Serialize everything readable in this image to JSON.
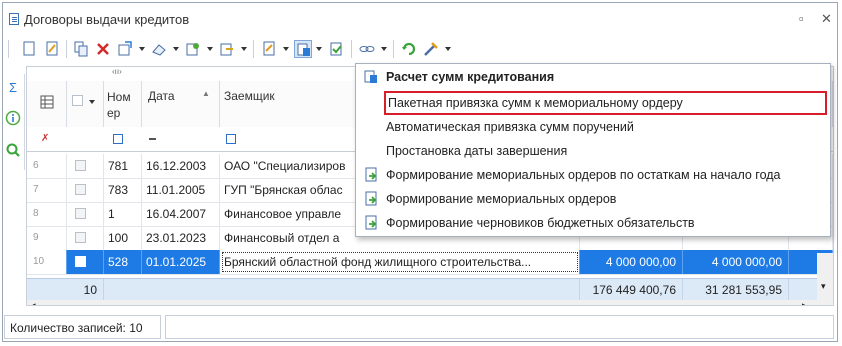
{
  "window": {
    "title": "Договоры выдачи кредитов",
    "restore_glyph": "▫",
    "close_glyph": "✕"
  },
  "grid": {
    "columns": {
      "number": "Ном ер",
      "date": "Дата",
      "borrower": "Заемщик"
    },
    "rows": [
      {
        "rownum": "6",
        "number": "781",
        "date": "16.12.2003",
        "borrower": "ОАО \"Специализиров",
        "sum1": "",
        "sum2": "",
        "selected": false
      },
      {
        "rownum": "7",
        "number": "783",
        "date": "11.01.2005",
        "borrower": "ГУП \"Брянская облас",
        "sum1": "",
        "sum2": "",
        "selected": false
      },
      {
        "rownum": "8",
        "number": "1",
        "date": "16.04.2007",
        "borrower": "Финансовое управле",
        "sum1": "",
        "sum2": "",
        "selected": false
      },
      {
        "rownum": "9",
        "number": "100",
        "date": "23.01.2023",
        "borrower": "Финансовый отдел а",
        "sum1": "",
        "sum2": "",
        "selected": false
      },
      {
        "rownum": "10",
        "number": "528",
        "date": "01.01.2025",
        "borrower": "Брянский областной фонд жилищного строительства...",
        "sum1": "4 000 000,00",
        "sum2": "4 000 000,00",
        "selected": true
      }
    ],
    "footer": {
      "count": "10",
      "total1": "176 449 400,76",
      "total2": "31 281 553,95"
    }
  },
  "status": {
    "records_label": "Количество записей: 10"
  },
  "menu": {
    "items": [
      {
        "label": "Расчет сумм кредитования",
        "bold": true,
        "highlighted": false,
        "icon": "calc-icon"
      },
      {
        "label": "Пакетная привязка сумм к мемориальному ордеру",
        "bold": false,
        "highlighted": true,
        "icon": ""
      },
      {
        "label": "Автоматическая привязка сумм поручений",
        "bold": false,
        "highlighted": false,
        "icon": ""
      },
      {
        "label": "Простановка даты завершения",
        "bold": false,
        "highlighted": false,
        "icon": ""
      },
      {
        "label": "Формирование мемориальных ордеров по остаткам на начало года",
        "bold": false,
        "highlighted": false,
        "icon": "doc-green-icon"
      },
      {
        "label": "Формирование мемориальных ордеров",
        "bold": false,
        "highlighted": false,
        "icon": "doc-green-icon"
      },
      {
        "label": "Формирование черновиков бюджетных обязательств",
        "bold": false,
        "highlighted": false,
        "icon": "doc-green-icon"
      }
    ]
  },
  "colors": {
    "selection": "#1e7be6",
    "footer": "#dce9f7",
    "highlight_border": "#d81e2a"
  }
}
